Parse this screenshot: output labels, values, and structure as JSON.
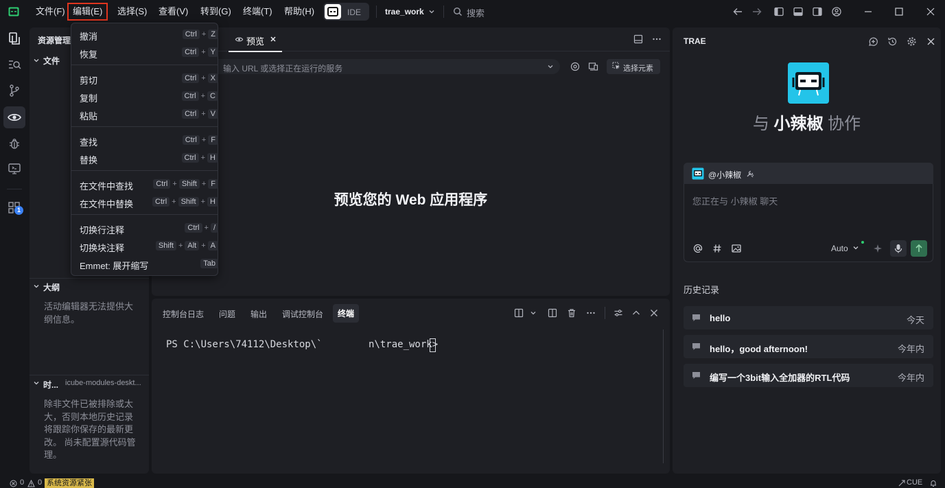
{
  "menubar": {
    "items": [
      "文件(F)",
      "编辑(E)",
      "选择(S)",
      "查看(V)",
      "转到(G)",
      "终端(T)",
      "帮助(H)"
    ],
    "ide_label": "IDE",
    "project": "trae_work",
    "search_placeholder": "搜索"
  },
  "edit_menu": {
    "groups": [
      [
        {
          "label": "撤消",
          "keys": [
            "Ctrl",
            "Z"
          ]
        },
        {
          "label": "恢复",
          "keys": [
            "Ctrl",
            "Y"
          ]
        }
      ],
      [
        {
          "label": "剪切",
          "keys": [
            "Ctrl",
            "X"
          ]
        },
        {
          "label": "复制",
          "keys": [
            "Ctrl",
            "C"
          ]
        },
        {
          "label": "粘贴",
          "keys": [
            "Ctrl",
            "V"
          ]
        }
      ],
      [
        {
          "label": "查找",
          "keys": [
            "Ctrl",
            "F"
          ]
        },
        {
          "label": "替换",
          "keys": [
            "Ctrl",
            "H"
          ]
        }
      ],
      [
        {
          "label": "在文件中查找",
          "keys": [
            "Ctrl",
            "Shift",
            "F"
          ]
        },
        {
          "label": "在文件中替换",
          "keys": [
            "Ctrl",
            "Shift",
            "H"
          ]
        }
      ],
      [
        {
          "label": "切换行注释",
          "keys": [
            "Ctrl",
            "/"
          ]
        },
        {
          "label": "切换块注释",
          "keys": [
            "Shift",
            "Alt",
            "A"
          ]
        },
        {
          "label": "Emmet: 展开缩写",
          "keys": [
            "Tab"
          ]
        }
      ]
    ]
  },
  "explorer": {
    "title": "资源管理",
    "files_section": "文件",
    "outline_section": "大纲",
    "outline_text": "活动编辑器无法提供大纲信息。",
    "timeline_section": "时...",
    "timeline_source": "icube-modules-deskt...",
    "timeline_text": "除非文件已被排除或太大，否则本地历史记录将跟踪你保存的最新更改。 尚未配置源代码管理。"
  },
  "preview": {
    "tab_label": "预览",
    "url_placeholder": "输入 URL 或选择正在运行的服务",
    "pick_element": "选择元素",
    "hero": "预览您的 Web 应用程序"
  },
  "panel": {
    "tabs": [
      "控制台日志",
      "问题",
      "输出",
      "调试控制台",
      "终端"
    ],
    "terminal_prompt": "PS C:\\Users\\74112\\Desktop\\`        n\\trae_work> "
  },
  "chat": {
    "title": "TRAE",
    "collab_prefix": "与",
    "agent_name": "小辣椒",
    "collab_suffix": "协作",
    "mention": "@小辣椒",
    "input_placeholder": "您正在与 小辣椒 聊天",
    "model": "Auto",
    "history_title": "历史记录",
    "history": [
      {
        "label": "hello",
        "date": "今天"
      },
      {
        "label": "hello，good afternoon!",
        "date": "今年内"
      },
      {
        "label": "编写一个3bit输入全加器的RTL代码",
        "date": "今年内"
      }
    ]
  },
  "status": {
    "errors": "0",
    "warnings": "0",
    "resource_warning": "系统资源紧张",
    "right_label": "CUE"
  },
  "activity": {
    "badge": "1"
  },
  "colors": {
    "accent": "#23c4e9",
    "highlight_border": "#e0351f",
    "send_button": "#2f6f4f"
  }
}
